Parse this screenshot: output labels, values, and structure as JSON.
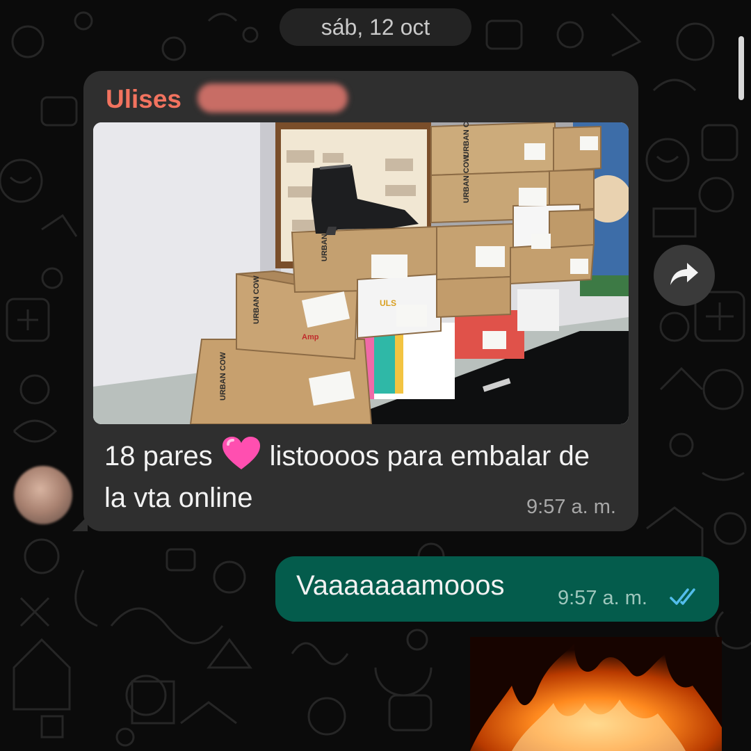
{
  "date_separator": "sáb, 12 oct",
  "incoming_message": {
    "sender": "Ulises",
    "text_before_emoji": "18 pares",
    "emoji": "pink-heart",
    "text_after_emoji": "listoooos para embalar de la vta online",
    "time": "9:57 a. m.",
    "photo_labels": {
      "brand": "URBAN COW",
      "box_label_1": "ULS",
      "box_label_2": "Amp"
    }
  },
  "outgoing_message": {
    "text": "Vaaaaaaamooos",
    "time": "9:57 a. m.",
    "status": "read"
  },
  "colors": {
    "sender_name": "#f2735f",
    "incoming_bubble": "#2f2f2f",
    "outgoing_bubble": "#045c4c",
    "read_ticks": "#53bdeb"
  },
  "icons": {
    "forward": "forward-arrow-icon",
    "read_receipt": "double-check-icon"
  }
}
